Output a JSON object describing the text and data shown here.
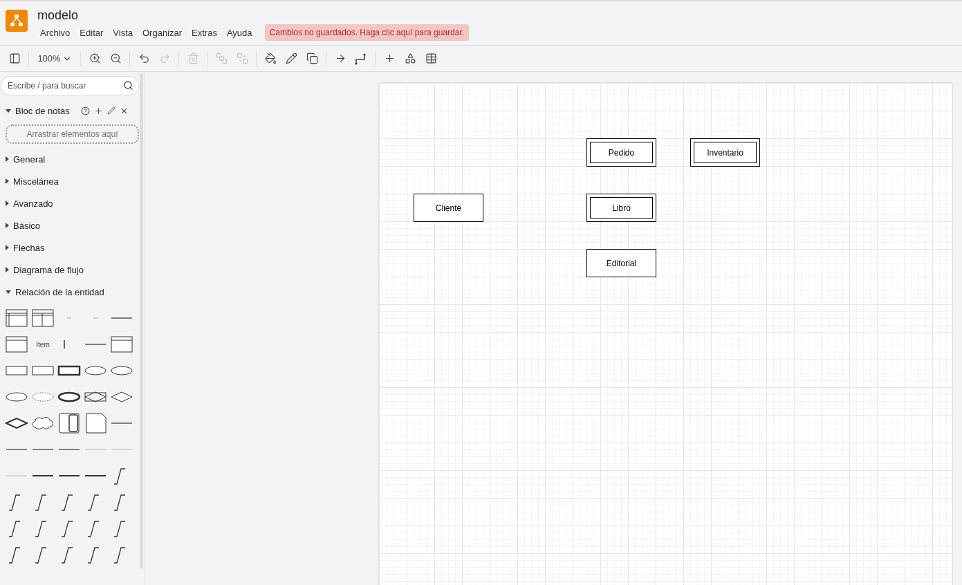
{
  "app": {
    "title": "modelo",
    "menu": [
      "Archivo",
      "Editar",
      "Vista",
      "Organizar",
      "Extras",
      "Ayuda"
    ],
    "unsaved_notice": "Cambios no guardados. Haga clic aquí para guardar."
  },
  "toolbar": [
    {
      "kind": "panel",
      "disabled": false
    },
    {
      "kind": "zoom",
      "label": "100%",
      "disabled": false
    },
    {
      "kind": "zoom-in",
      "disabled": false
    },
    {
      "kind": "zoom-out",
      "disabled": false
    },
    {
      "kind": "undo",
      "disabled": false
    },
    {
      "kind": "redo",
      "disabled": true
    },
    {
      "kind": "delete",
      "disabled": true
    },
    {
      "kind": "to-front",
      "disabled": true
    },
    {
      "kind": "to-back",
      "disabled": true
    },
    {
      "kind": "fill",
      "disabled": false
    },
    {
      "kind": "line",
      "disabled": false
    },
    {
      "kind": "shadow",
      "disabled": false
    },
    {
      "kind": "connector",
      "disabled": false
    },
    {
      "kind": "waypoint",
      "disabled": false
    },
    {
      "kind": "insert",
      "disabled": false
    },
    {
      "kind": "shapes",
      "disabled": false
    },
    {
      "kind": "table",
      "disabled": false
    }
  ],
  "sidebar": {
    "search": {
      "placeholder": "Escribe / para buscar"
    },
    "scratchpad": {
      "title": "Bloc de notas",
      "expanded": true,
      "dropzone": "Arrastrar elementos aquí"
    },
    "sections": [
      {
        "label": "General",
        "expanded": false
      },
      {
        "label": "Miscelánea",
        "expanded": false
      },
      {
        "label": "Avanzado",
        "expanded": false
      },
      {
        "label": "Básico",
        "expanded": false
      },
      {
        "label": "Flechas",
        "expanded": false
      },
      {
        "label": "Diagrama de flujo",
        "expanded": false
      },
      {
        "label": "Relación de la entidad",
        "expanded": true
      }
    ],
    "palette": [
      {
        "kind": "table"
      },
      {
        "kind": "table"
      },
      {
        "kind": "dot"
      },
      {
        "kind": "dot"
      },
      {
        "kind": "line"
      },
      {
        "kind": "list"
      },
      {
        "kind": "text",
        "label": "Item"
      },
      {
        "kind": "bar"
      },
      {
        "kind": "line"
      },
      {
        "kind": "list"
      },
      {
        "kind": "entity"
      },
      {
        "kind": "entity"
      },
      {
        "kind": "strong-entity"
      },
      {
        "kind": "ellipse"
      },
      {
        "kind": "ellipse"
      },
      {
        "kind": "ellipse"
      },
      {
        "kind": "dotted-ellipse"
      },
      {
        "kind": "thick-ellipse"
      },
      {
        "kind": "assoc"
      },
      {
        "kind": "diamond"
      },
      {
        "kind": "thick-diamond"
      },
      {
        "kind": "cloud"
      },
      {
        "kind": "split"
      },
      {
        "kind": "note"
      },
      {
        "kind": "line"
      },
      {
        "kind": "line"
      },
      {
        "kind": "line"
      },
      {
        "kind": "line"
      },
      {
        "kind": "faint-line"
      },
      {
        "kind": "faint-line"
      },
      {
        "kind": "faint-line"
      },
      {
        "kind": "thick-line"
      },
      {
        "kind": "thick-line"
      },
      {
        "kind": "thick-line"
      },
      {
        "kind": "step"
      },
      {
        "kind": "step"
      },
      {
        "kind": "step"
      },
      {
        "kind": "step"
      },
      {
        "kind": "step"
      },
      {
        "kind": "step"
      },
      {
        "kind": "step"
      },
      {
        "kind": "step"
      },
      {
        "kind": "step"
      },
      {
        "kind": "step"
      },
      {
        "kind": "step"
      },
      {
        "kind": "step"
      },
      {
        "kind": "step"
      },
      {
        "kind": "step"
      },
      {
        "kind": "step"
      },
      {
        "kind": "step"
      }
    ]
  },
  "diagram": {
    "entities": [
      {
        "label": "Pedido",
        "double": true
      },
      {
        "label": "Inventario",
        "double": true
      },
      {
        "label": "Cliente",
        "double": false
      },
      {
        "label": "Libro",
        "double": true
      },
      {
        "label": "Editorial",
        "double": false
      }
    ]
  }
}
